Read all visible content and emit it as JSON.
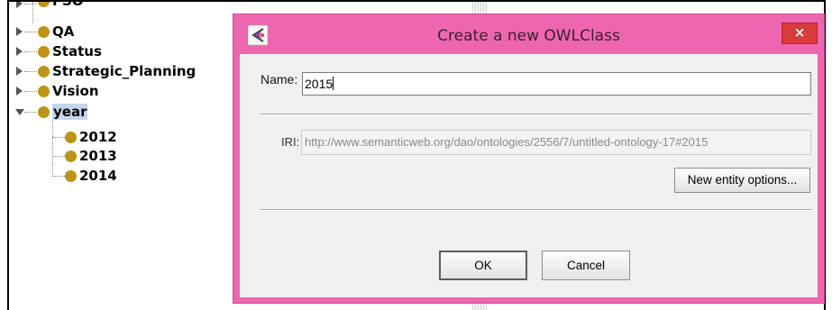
{
  "tree": {
    "items": [
      {
        "label": "PSO"
      },
      {
        "label": "QA"
      },
      {
        "label": "Status"
      },
      {
        "label": "Strategic_Planning"
      },
      {
        "label": "Vision"
      },
      {
        "label": "year"
      },
      {
        "label": "2012"
      },
      {
        "label": "2013"
      },
      {
        "label": "2014"
      }
    ]
  },
  "dialog": {
    "title": "Create a new OWLClass",
    "close_label": "×",
    "name_label": "Name:",
    "name_value": "2015",
    "iri_label": "IRI:",
    "iri_value": "http://www.semanticweb.org/dao/ontologies/2556/7/untitled-ontology-17#2015",
    "options_button": "New entity options...",
    "ok_button": "OK",
    "cancel_button": "Cancel"
  },
  "colors": {
    "dialog_frame": "#ef66b0",
    "class_bullet": "#bd9416",
    "selection": "#c6d5ee",
    "close_button": "#d93a3a"
  },
  "icons": [
    "expand-arrow-icon",
    "collapse-arrow-icon",
    "class-bullet-icon",
    "protege-app-icon",
    "close-icon"
  ]
}
